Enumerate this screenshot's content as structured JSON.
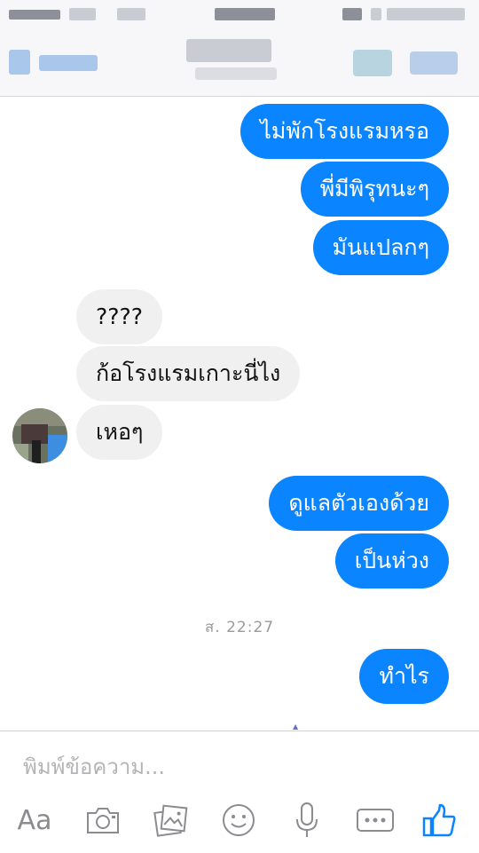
{
  "conversation": {
    "messages": [
      {
        "direction": "outgoing",
        "text": "ไม่พักโรงแรมหรอ"
      },
      {
        "direction": "outgoing",
        "text": "พี่มีพิรุทนะๆ"
      },
      {
        "direction": "outgoing",
        "text": "มันแปลกๆ"
      },
      {
        "direction": "incoming",
        "text": "????"
      },
      {
        "direction": "incoming",
        "text": "ก้อโรงแรมเกาะนี่ไง"
      },
      {
        "direction": "incoming",
        "text": "เหอๆ"
      },
      {
        "direction": "outgoing",
        "text": "ดูแลตัวเองด้วย"
      },
      {
        "direction": "outgoing",
        "text": "เป็นห่วง"
      },
      {
        "direction": "outgoing",
        "text": "ทำไร"
      }
    ],
    "timestamp": "ส. 22:27"
  },
  "composer": {
    "placeholder": "พิมพ์ข้อความ...",
    "text_button_label": "Aa",
    "icons": [
      "camera-icon",
      "photo-gallery-icon",
      "emoji-icon",
      "microphone-icon",
      "more-options-icon",
      "like-thumbs-up-icon"
    ]
  },
  "colors": {
    "outgoing_bubble": "#0a84ff",
    "incoming_bubble": "#f1f0f0",
    "accent": "#0a84ff",
    "toolbar_icon": "#8b8b90"
  }
}
